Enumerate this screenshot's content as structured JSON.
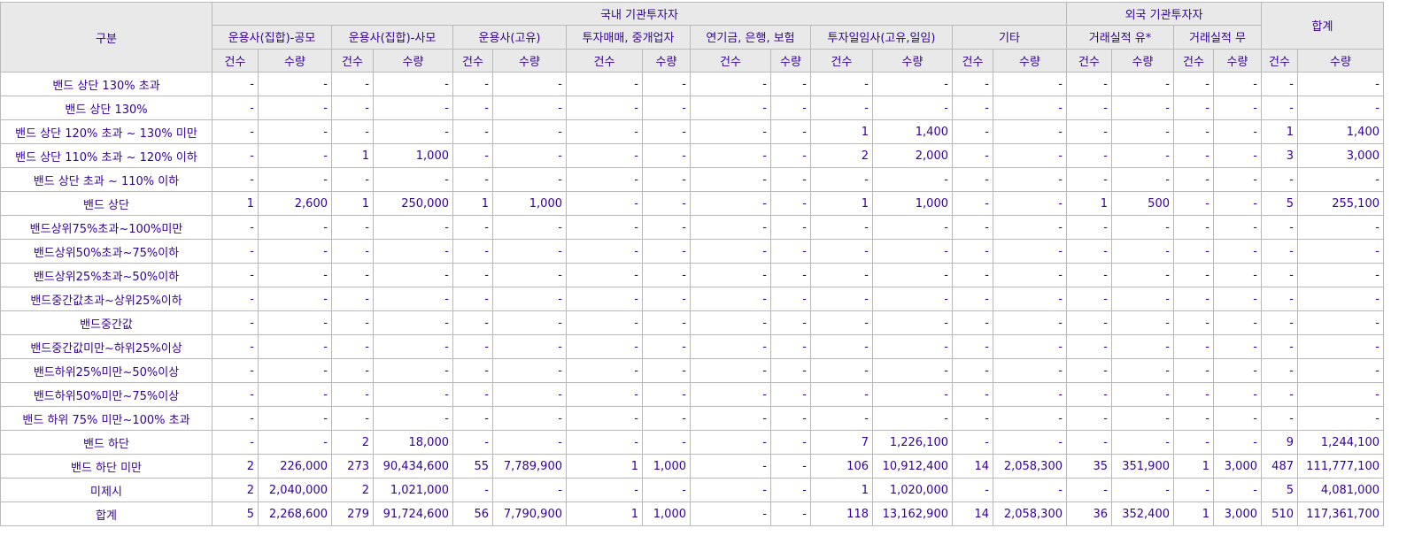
{
  "headers": {
    "gubun": "구분",
    "domestic": "국내 기관투자자",
    "foreign": "외국 기관투자자",
    "total": "합계",
    "groups": [
      "운용사(집합)-공모",
      "운용사(집합)-사모",
      "운용사(고유)",
      "투자매매, 중개업자",
      "연기금, 은행, 보험",
      "투자일임사(고유,일임)",
      "기타",
      "거래실적 유*",
      "거래실적 무"
    ],
    "count_label": "건수",
    "qty_label": "수량"
  },
  "rows": [
    {
      "label": "밴드 상단 130% 초과",
      "cells": [
        "-",
        "-",
        "-",
        "-",
        "-",
        "-",
        "-",
        "-",
        "-",
        "-",
        "-",
        "-",
        "-",
        "-",
        "-",
        "-",
        "-",
        "-",
        "-",
        "-"
      ]
    },
    {
      "label": "밴드 상단 130%",
      "cells": [
        "-",
        "-",
        "-",
        "-",
        "-",
        "-",
        "-",
        "-",
        "-",
        "-",
        "-",
        "-",
        "-",
        "-",
        "-",
        "-",
        "-",
        "-",
        "-",
        "-"
      ]
    },
    {
      "label": "밴드 상단 120% 초과 ~ 130% 미만",
      "cells": [
        "-",
        "-",
        "-",
        "-",
        "-",
        "-",
        "-",
        "-",
        "-",
        "-",
        "1",
        "1,400",
        "-",
        "-",
        "-",
        "-",
        "-",
        "-",
        "1",
        "1,400"
      ]
    },
    {
      "label": "밴드 상단 110% 초과 ~ 120% 이하",
      "cells": [
        "-",
        "-",
        "1",
        "1,000",
        "-",
        "-",
        "-",
        "-",
        "-",
        "-",
        "2",
        "2,000",
        "-",
        "-",
        "-",
        "-",
        "-",
        "-",
        "3",
        "3,000"
      ]
    },
    {
      "label": "밴드 상단 초과 ~ 110% 이하",
      "cells": [
        "-",
        "-",
        "-",
        "-",
        "-",
        "-",
        "-",
        "-",
        "-",
        "-",
        "-",
        "-",
        "-",
        "-",
        "-",
        "-",
        "-",
        "-",
        "-",
        "-"
      ]
    },
    {
      "label": "밴드 상단",
      "cells": [
        "1",
        "2,600",
        "1",
        "250,000",
        "1",
        "1,000",
        "-",
        "-",
        "-",
        "-",
        "1",
        "1,000",
        "-",
        "-",
        "1",
        "500",
        "-",
        "-",
        "5",
        "255,100"
      ]
    },
    {
      "label": "밴드상위75%초과~100%미만",
      "cells": [
        "-",
        "-",
        "-",
        "-",
        "-",
        "-",
        "-",
        "-",
        "-",
        "-",
        "-",
        "-",
        "-",
        "-",
        "-",
        "-",
        "-",
        "-",
        "-",
        "-"
      ]
    },
    {
      "label": "밴드상위50%초과~75%이하",
      "cells": [
        "-",
        "-",
        "-",
        "-",
        "-",
        "-",
        "-",
        "-",
        "-",
        "-",
        "-",
        "-",
        "-",
        "-",
        "-",
        "-",
        "-",
        "-",
        "-",
        "-"
      ]
    },
    {
      "label": "밴드상위25%초과~50%이하",
      "cells": [
        "-",
        "-",
        "-",
        "-",
        "-",
        "-",
        "-",
        "-",
        "-",
        "-",
        "-",
        "-",
        "-",
        "-",
        "-",
        "-",
        "-",
        "-",
        "-",
        "-"
      ]
    },
    {
      "label": "밴드중간값초과~상위25%이하",
      "cells": [
        "-",
        "-",
        "-",
        "-",
        "-",
        "-",
        "-",
        "-",
        "-",
        "-",
        "-",
        "-",
        "-",
        "-",
        "-",
        "-",
        "-",
        "-",
        "-",
        "-"
      ]
    },
    {
      "label": "밴드중간값",
      "cells": [
        "-",
        "-",
        "-",
        "-",
        "-",
        "-",
        "-",
        "-",
        "-",
        "-",
        "-",
        "-",
        "-",
        "-",
        "-",
        "-",
        "-",
        "-",
        "-",
        "-"
      ]
    },
    {
      "label": "밴드중간값미만~하위25%이상",
      "cells": [
        "-",
        "-",
        "-",
        "-",
        "-",
        "-",
        "-",
        "-",
        "-",
        "-",
        "-",
        "-",
        "-",
        "-",
        "-",
        "-",
        "-",
        "-",
        "-",
        "-"
      ]
    },
    {
      "label": "밴드하위25%미만~50%이상",
      "cells": [
        "-",
        "-",
        "-",
        "-",
        "-",
        "-",
        "-",
        "-",
        "-",
        "-",
        "-",
        "-",
        "-",
        "-",
        "-",
        "-",
        "-",
        "-",
        "-",
        "-"
      ]
    },
    {
      "label": "밴드하위50%미만~75%이상",
      "cells": [
        "-",
        "-",
        "-",
        "-",
        "-",
        "-",
        "-",
        "-",
        "-",
        "-",
        "-",
        "-",
        "-",
        "-",
        "-",
        "-",
        "-",
        "-",
        "-",
        "-"
      ]
    },
    {
      "label": "밴드 하위 75% 미만~100% 초과",
      "cells": [
        "-",
        "-",
        "-",
        "-",
        "-",
        "-",
        "-",
        "-",
        "-",
        "-",
        "-",
        "-",
        "-",
        "-",
        "-",
        "-",
        "-",
        "-",
        "-",
        "-"
      ]
    },
    {
      "label": "밴드 하단",
      "cells": [
        "-",
        "-",
        "2",
        "18,000",
        "-",
        "-",
        "-",
        "-",
        "-",
        "-",
        "7",
        "1,226,100",
        "-",
        "-",
        "-",
        "-",
        "-",
        "-",
        "9",
        "1,244,100"
      ]
    },
    {
      "label": "밴드 하단 미만",
      "cells": [
        "2",
        "226,000",
        "273",
        "90,434,600",
        "55",
        "7,789,900",
        "1",
        "1,000",
        "-",
        "-",
        "106",
        "10,912,400",
        "14",
        "2,058,300",
        "35",
        "351,900",
        "1",
        "3,000",
        "487",
        "111,777,100"
      ]
    },
    {
      "label": "미제시",
      "cells": [
        "2",
        "2,040,000",
        "2",
        "1,021,000",
        "-",
        "-",
        "-",
        "-",
        "-",
        "-",
        "1",
        "1,020,000",
        "-",
        "-",
        "-",
        "-",
        "-",
        "-",
        "5",
        "4,081,000"
      ]
    },
    {
      "label": "합계",
      "cells": [
        "5",
        "2,268,600",
        "279",
        "91,724,600",
        "56",
        "7,790,900",
        "1",
        "1,000",
        "-",
        "-",
        "118",
        "13,162,900",
        "14",
        "2,058,300",
        "36",
        "352,400",
        "1",
        "3,000",
        "510",
        "117,361,700"
      ]
    }
  ]
}
